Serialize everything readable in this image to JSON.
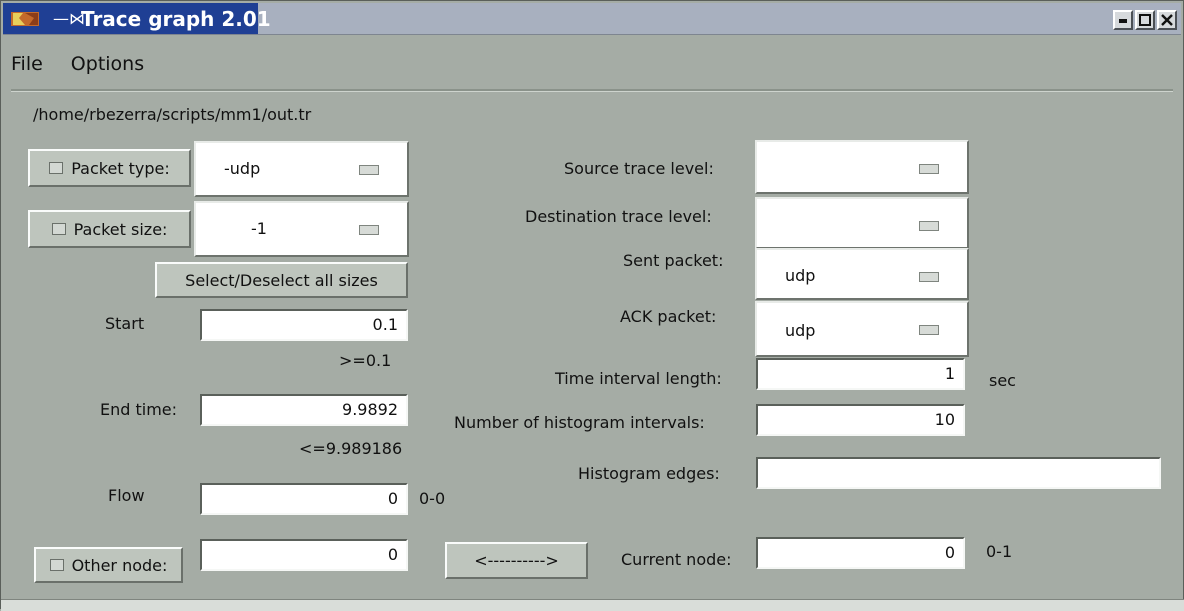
{
  "window": {
    "title": "Trace graph 2.01",
    "title_color": "#1f3f94"
  },
  "menu": [
    {
      "label": "File"
    },
    {
      "label": "Options"
    }
  ],
  "path": "/home/rbezerra/scripts/mm1/out.tr",
  "left": {
    "packet_type_button": "Packet type:",
    "packet_type_value": "-udp",
    "packet_size_button": "Packet size:",
    "packet_size_value": "-1",
    "select_sizes_button": "Select/Deselect all sizes",
    "start_label": "Start",
    "start_value": "0.1",
    "start_hint": ">=0.1",
    "end_label": "End time:",
    "end_value": "9.9892",
    "end_hint": "<=9.989186",
    "flow_label": "Flow",
    "flow_value": "0",
    "flow_range": "0-0",
    "other_node_button": "Other node:",
    "other_node_value": "0"
  },
  "center": {
    "nav_button": "<---------->",
    "source_trace_label": "Source trace level:",
    "destination_trace_label": "Destination trace level:",
    "sent_packet_label": "Sent packet:",
    "ack_packet_label": "ACK packet:",
    "time_interval_label": "Time interval length:",
    "hist_intervals_label": "Number of histogram intervals:",
    "hist_edges_label": "Histogram edges:",
    "current_node_label": "Current node:"
  },
  "right": {
    "source_trace_value": "",
    "destination_trace_value": "",
    "sent_packet_value": "udp",
    "ack_packet_value": "udp",
    "time_interval_value": "1",
    "time_interval_unit": "sec",
    "hist_intervals_value": "10",
    "hist_edges_value": "",
    "current_node_value": "0",
    "current_node_range": "0-1"
  }
}
